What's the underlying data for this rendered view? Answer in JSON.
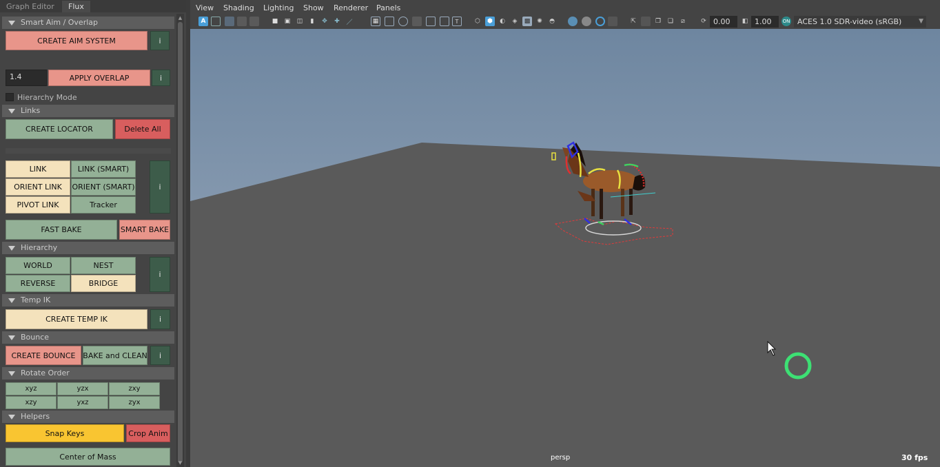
{
  "tabs": [
    {
      "label": "Graph Editor",
      "active": false
    },
    {
      "label": "Flux",
      "active": true
    }
  ],
  "sections": {
    "smart_aim": {
      "title": "Smart Aim / Overlap",
      "create_aim": "CREATE AIM SYSTEM",
      "info": "i",
      "overlap_value": "1.4",
      "apply_overlap": "APPLY OVERLAP",
      "hierarchy_mode": "Hierarchy Mode"
    },
    "links": {
      "title": "Links",
      "create_locator": "CREATE LOCATOR",
      "delete_all": "Delete All",
      "link": "LINK",
      "link_smart": "LINK (SMART)",
      "orient_link": "ORIENT LINK",
      "orient_smart": "ORIENT (SMART)",
      "pivot_link": "PIVOT LINK",
      "tracker": "Tracker",
      "info": "i",
      "fast_bake": "FAST BAKE",
      "smart_bake": "SMART BAKE"
    },
    "hierarchy": {
      "title": "Hierarchy",
      "world": "WORLD",
      "nest": "NEST",
      "reverse": "REVERSE",
      "bridge": "BRIDGE",
      "info": "i"
    },
    "temp_ik": {
      "title": "Temp IK",
      "create": "CREATE TEMP IK",
      "info": "i"
    },
    "bounce": {
      "title": "Bounce",
      "create": "CREATE BOUNCE",
      "bake_clean": "BAKE and CLEAN",
      "info": "i"
    },
    "rotate_order": {
      "title": "Rotate Order",
      "orders": [
        "xyz",
        "yzx",
        "zxy",
        "xzy",
        "yxz",
        "zyx"
      ]
    },
    "helpers": {
      "title": "Helpers",
      "snap_keys": "Snap Keys",
      "crop_anim": "Crop Anim",
      "center_of_mass": "Center of Mass"
    }
  },
  "viewport": {
    "menus": [
      "View",
      "Shading",
      "Lighting",
      "Show",
      "Renderer",
      "Panels"
    ],
    "exposure": "0.00",
    "gamma": "1.00",
    "color_space": "ACES 1.0 SDR-video (sRGB)",
    "camera": "persp",
    "fps": "30 fps"
  },
  "colors": {
    "pink": "#e8958a",
    "red": "#d85e5e",
    "green": "#93b096",
    "cream": "#f4e2bc",
    "yellow": "#f9c531",
    "info": "#3d5c4a",
    "sky_top": "#6e86a0",
    "sky_bottom": "#a4b2c3",
    "ground": "#5a5a5a"
  }
}
